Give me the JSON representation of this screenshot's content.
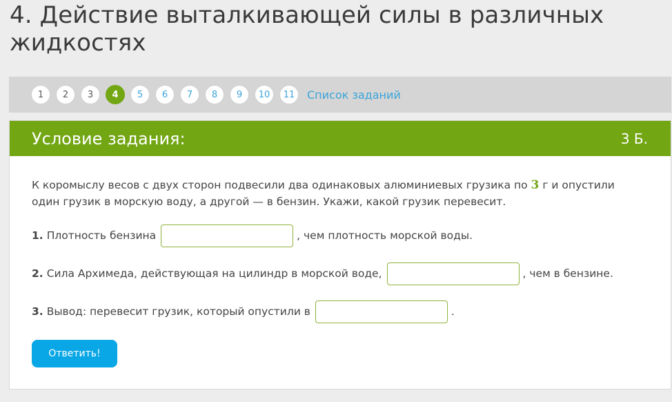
{
  "page": {
    "title": "4. Действие выталкивающей силы в различных жидкостях"
  },
  "nav": {
    "items": [
      "1",
      "2",
      "3",
      "4",
      "5",
      "6",
      "7",
      "8",
      "9",
      "10",
      "11"
    ],
    "active_index": 3,
    "task_list_label": "Список заданий"
  },
  "task": {
    "header_title": "Условие задания:",
    "points": "3 Б.",
    "intro_before": "К коромыслу весов с двух сторон подвесили два одинаковых алюминиевых грузика по ",
    "intro_mass": "3",
    "intro_after": " г и опустили один грузик в морскую воду, а другой — в бензин. Укажи, какой грузик перевесит.",
    "questions": [
      {
        "num": "1.",
        "before": "Плотность бензина",
        "after": ", чем плотность морской воды.",
        "value": "",
        "placeholder": ""
      },
      {
        "num": "2.",
        "before": "Сила Архимеда, действующая на цилиндр в морской воде,",
        "after": ", чем в бензине.",
        "value": "",
        "placeholder": ""
      },
      {
        "num": "3.",
        "before": "Вывод: перевесит грузик, который опустили в",
        "after": ".",
        "value": "",
        "placeholder": ""
      }
    ],
    "submit_label": "Ответить!"
  },
  "colors": {
    "accent_green": "#72a613",
    "link_blue": "#3aa3d8",
    "button_blue": "#0aa7e6"
  }
}
